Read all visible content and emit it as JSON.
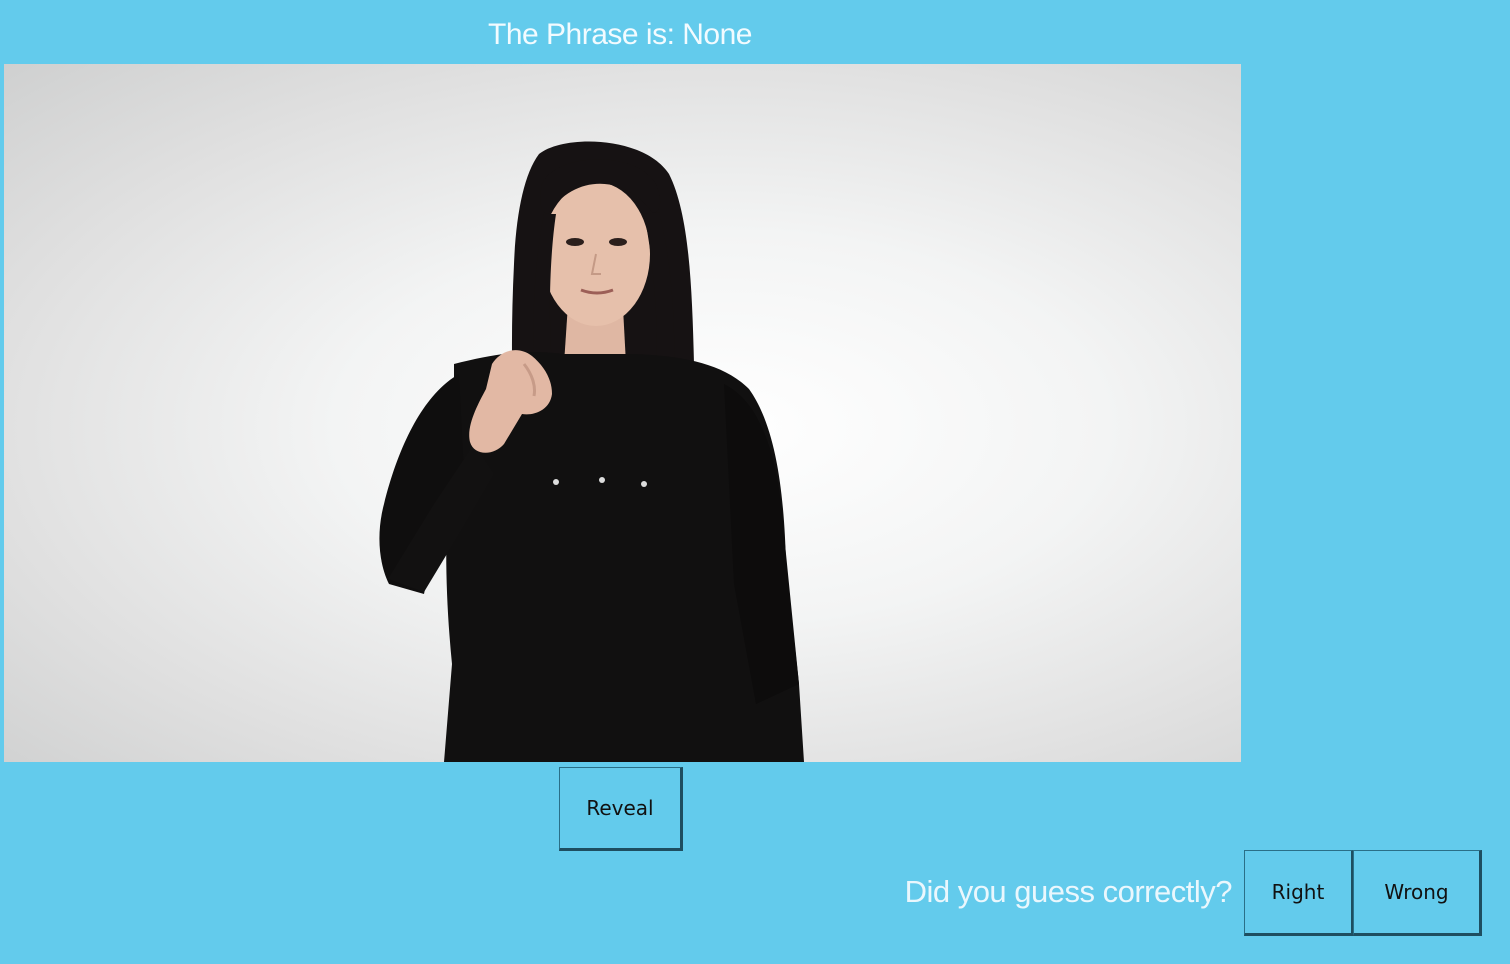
{
  "header": {
    "phrase_text": "The Phrase is: None"
  },
  "video": {
    "icon": "signer-video-frame"
  },
  "controls": {
    "reveal_label": "Reveal",
    "question_text": "Did you guess correctly?",
    "right_label": "Right",
    "wrong_label": "Wrong"
  },
  "colors": {
    "background": "#63cbec",
    "text_light": "#f2fbff",
    "button_text": "#111111"
  }
}
